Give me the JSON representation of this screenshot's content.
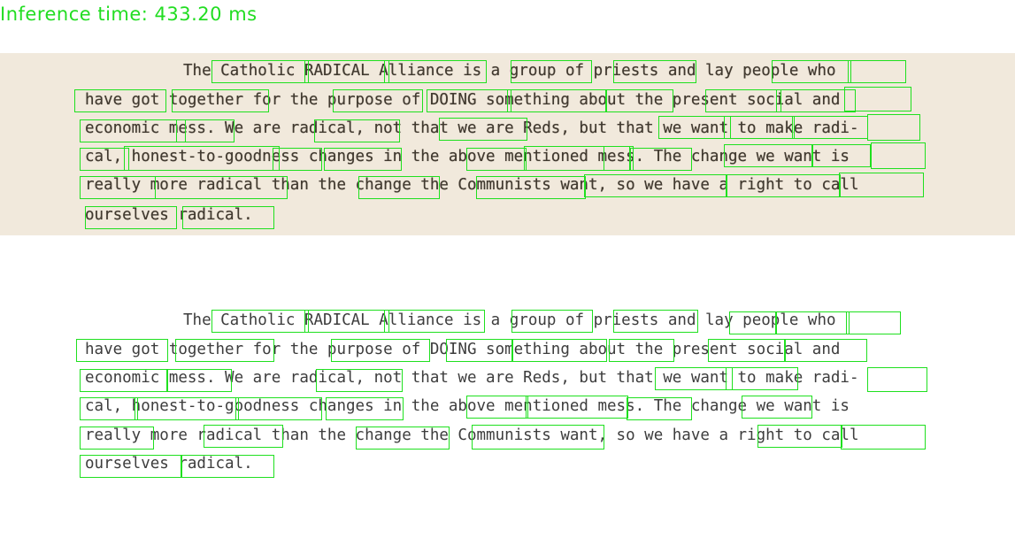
{
  "header": {
    "inference_text": "Inference time: 433.20 ms"
  },
  "paragraph": {
    "lines": [
      "The Catholic RADICAL Alliance is a group of priests and lay people who",
      "have got together for the purpose of DOING something about the present social and",
      "economic mess.  We are radical, not that we are Reds, but that we want to make radi-",
      "cal, honest-to-goodness changes in the above mentioned mess.  The change we want is",
      "really more radical than the change the Communists want, so we have a right to call",
      "ourselves radical."
    ]
  },
  "colors": {
    "box": "#1fe01f",
    "scan_background": "#f1e9dc",
    "clean_background": "#ffffff"
  }
}
